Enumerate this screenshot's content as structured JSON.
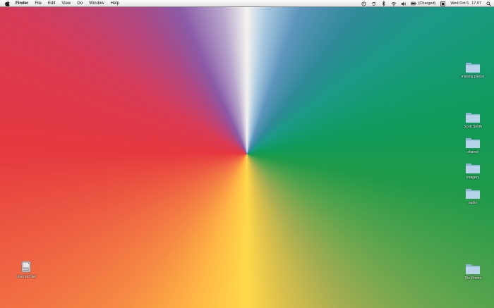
{
  "menubar": {
    "apple_icon": "apple-icon",
    "app_name": "Finder",
    "menus": [
      "File",
      "Edit",
      "View",
      "Go",
      "Window",
      "Help"
    ],
    "status": {
      "icons": [
        "time-machine-icon",
        "sync-icon",
        "bluetooth-icon",
        "wifi-icon",
        "volume-icon",
        "battery-icon"
      ],
      "battery_label": "(Charged)",
      "day_date": "Wed Oct 5",
      "time": "17:07",
      "spotlight_icon": "spotlight-icon"
    }
  },
  "desktop": {
    "wallpaper_colors": [
      "#f4f2ef",
      "#5d95bd",
      "#109a5a",
      "#ffd94a",
      "#e5373f",
      "#8b5ba8"
    ],
    "icons": [
      {
        "name": "missing pieces",
        "kind": "folder-icon"
      },
      {
        "name": "Scott Smith",
        "kind": "folder-icon"
      },
      {
        "name": "shared",
        "kind": "folder-icon"
      },
      {
        "name": "imagery",
        "kind": "folder-icon"
      },
      {
        "name": "audio",
        "kind": "folder-icon"
      },
      {
        "name": "The Promo",
        "kind": "folder-icon"
      },
      {
        "name": "Internal Disk",
        "kind": "hard-drive-icon"
      }
    ]
  }
}
